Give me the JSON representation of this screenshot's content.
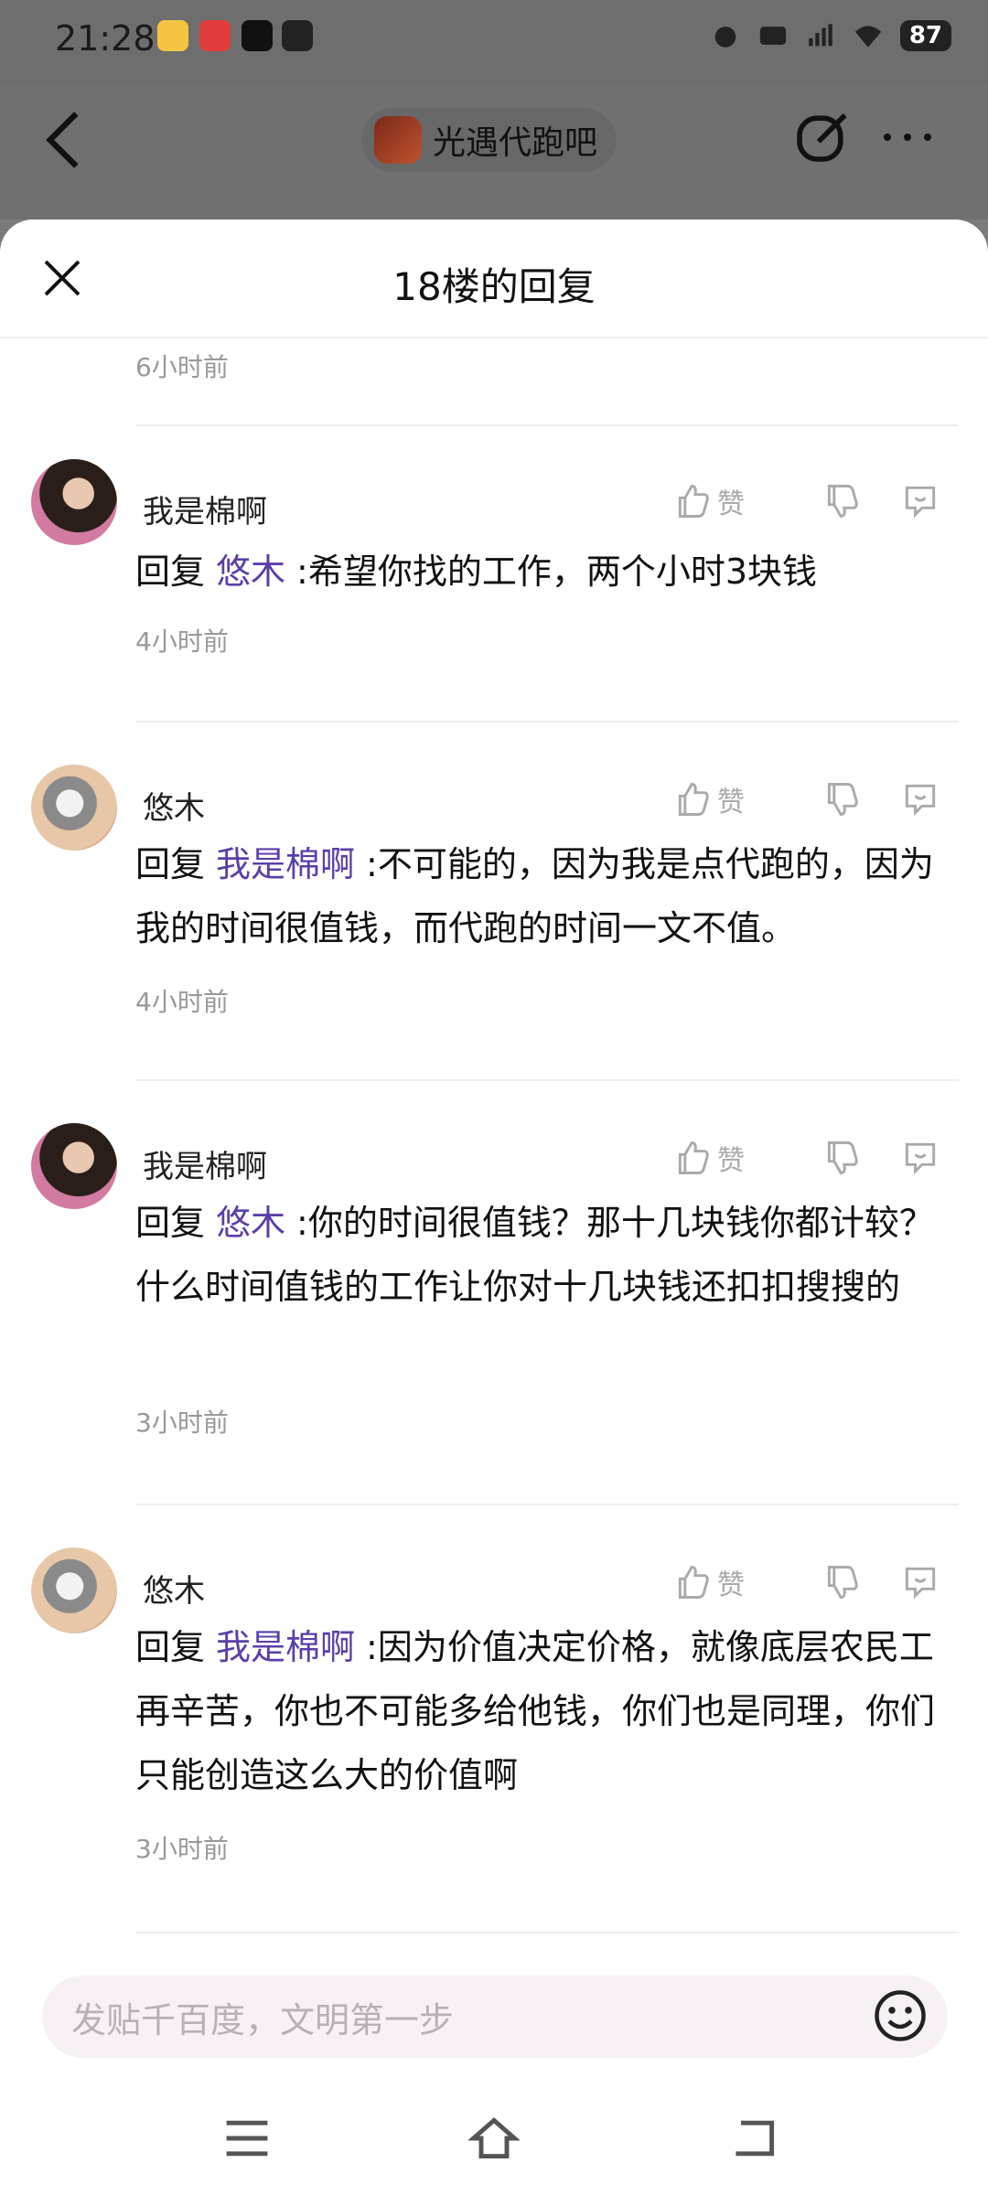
{
  "status": {
    "time": "21:28",
    "battery": "87"
  },
  "header": {
    "forum_name": "光遇代跑吧"
  },
  "sheet": {
    "title": "18楼的回复",
    "top_time": "6小时前"
  },
  "reply_prefix": "回复",
  "like_label": "赞",
  "replies": [
    {
      "user": "我是棉啊",
      "mention": "悠木",
      "text": ":希望你找的工作，两个小时3块钱",
      "time": "4小时前"
    },
    {
      "user": "悠木",
      "mention": "我是棉啊",
      "text": ":不可能的，因为我是点代跑的，因为我的时间很值钱，而代跑的时间一文不值。",
      "time": "4小时前"
    },
    {
      "user": "我是棉啊",
      "mention": "悠木",
      "text": ":你的时间很值钱？那十几块钱你都计较？什么时间值钱的工作让你对十几块钱还扣扣搜搜的",
      "time": "3小时前"
    },
    {
      "user": "悠木",
      "mention": "我是棉啊",
      "text": ":因为价值决定价格，就像底层农民工再辛苦，你也不可能多给他钱，你们也是同理，你们只能创造这么大的价值啊",
      "time": "3小时前"
    }
  ],
  "composer": {
    "placeholder": "发贴千百度，文明第一步"
  }
}
